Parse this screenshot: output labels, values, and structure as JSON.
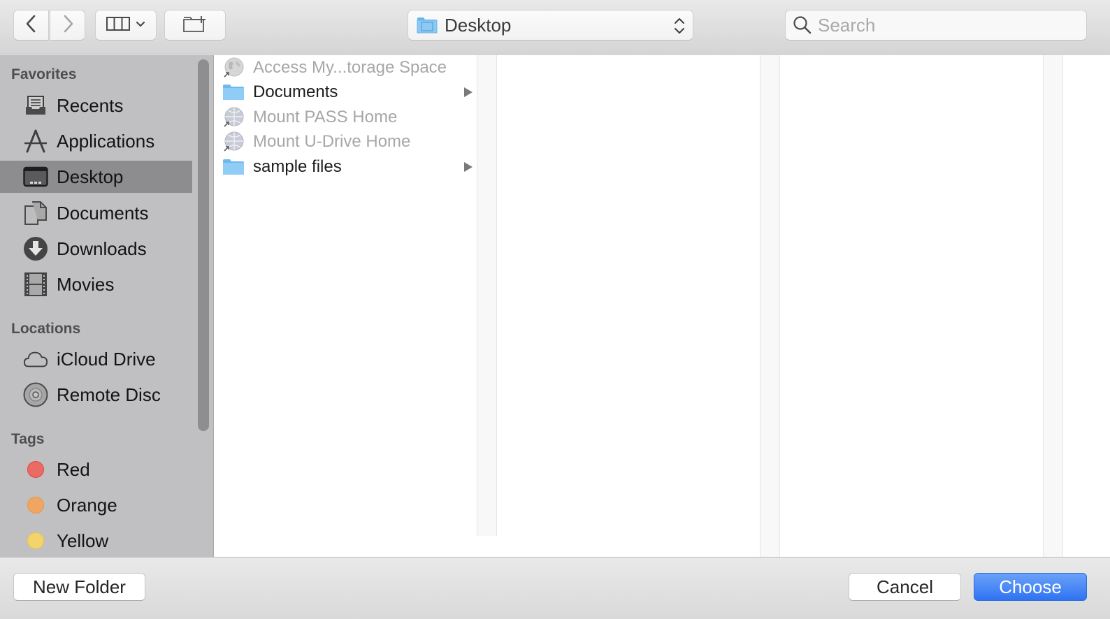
{
  "toolbar": {
    "back_icon": "chevron-left-icon",
    "forward_icon": "chevron-right-icon",
    "view_icon": "column-view-icon",
    "new_folder_icon": "new-folder-icon",
    "path_popup": {
      "label": "Desktop",
      "icon": "folder-desktop-icon"
    },
    "search": {
      "placeholder": "Search",
      "value": ""
    }
  },
  "sidebar": {
    "sections": [
      {
        "title": "Favorites",
        "items": [
          {
            "label": "Recents",
            "icon": "recents-icon"
          },
          {
            "label": "Applications",
            "icon": "applications-icon"
          },
          {
            "label": "Desktop",
            "icon": "desktop-icon",
            "selected": true
          },
          {
            "label": "Documents",
            "icon": "documents-icon"
          },
          {
            "label": "Downloads",
            "icon": "downloads-icon"
          },
          {
            "label": "Movies",
            "icon": "movies-icon"
          }
        ]
      },
      {
        "title": "Locations",
        "items": [
          {
            "label": "iCloud Drive",
            "icon": "cloud-icon"
          },
          {
            "label": "Remote Disc",
            "icon": "disc-icon"
          }
        ]
      },
      {
        "title": "Tags",
        "items": [
          {
            "label": "Red",
            "color": "#ec5f5a"
          },
          {
            "label": "Orange",
            "color": "#f0a45b"
          },
          {
            "label": "Yellow",
            "color": "#f4d168"
          }
        ]
      }
    ]
  },
  "browser": {
    "column1": [
      {
        "label": "Access My...torage Space",
        "icon": "network-alias-icon",
        "enabled": false,
        "has_children": false
      },
      {
        "label": "Documents",
        "icon": "folder-icon",
        "enabled": true,
        "has_children": true
      },
      {
        "label": "Mount PASS Home",
        "icon": "network-alias-icon",
        "enabled": false,
        "has_children": false
      },
      {
        "label": "Mount U-Drive Home",
        "icon": "network-alias-icon",
        "enabled": false,
        "has_children": false
      },
      {
        "label": "sample files",
        "icon": "folder-icon",
        "enabled": true,
        "has_children": true
      }
    ]
  },
  "footer": {
    "new_folder_label": "New Folder",
    "cancel_label": "Cancel",
    "choose_label": "Choose",
    "accent_color": "#2f73f2"
  }
}
